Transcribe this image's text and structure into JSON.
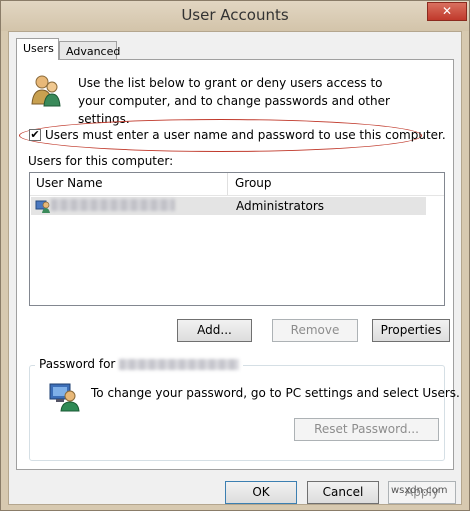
{
  "window": {
    "title": "User Accounts",
    "close_glyph": "✕"
  },
  "tabs": [
    {
      "label": "Users",
      "active": true
    },
    {
      "label": "Advanced",
      "active": false
    }
  ],
  "intro": {
    "icon": "users-group-icon",
    "text": "Use the list below to grant or deny users access to your computer, and to change passwords and other settings."
  },
  "require_login": {
    "checked": true,
    "check_glyph": "✔",
    "label": "Users must enter a user name and password to use this computer."
  },
  "users_list": {
    "label": "Users for this computer:",
    "columns": [
      "User Name",
      "Group"
    ],
    "rows": [
      {
        "icon": "user-account-icon",
        "user_name": "",
        "group": "Administrators"
      }
    ]
  },
  "list_buttons": {
    "add": "Add...",
    "remove": "Remove",
    "properties": "Properties"
  },
  "password_group": {
    "legend": "Password for",
    "icon": "password-user-icon",
    "text": "To change your password, go to PC settings and select Users.",
    "reset_button": "Reset Password..."
  },
  "footer": {
    "ok": "OK",
    "cancel": "Cancel",
    "apply": "Apply"
  },
  "watermark": "wsxdn.com",
  "colors": {
    "title_bar": "#d7c9b0",
    "close_button": "#c0392b",
    "highlight_ellipse": "#c0392b"
  }
}
